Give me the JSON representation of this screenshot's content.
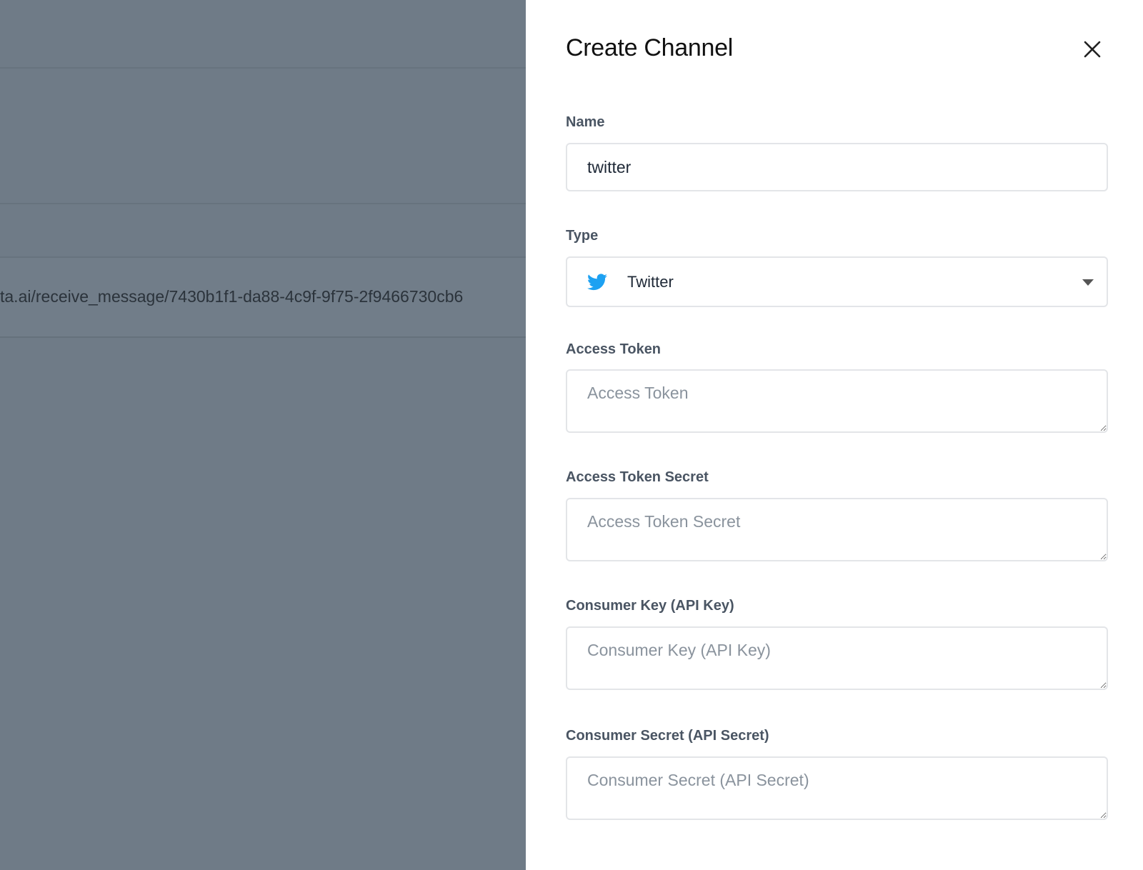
{
  "background": {
    "webhook_url_fragment": "ta.ai/receive_message/7430b1f1-da88-4c9f-9f75-2f9466730cb6"
  },
  "panel": {
    "title": "Create Channel",
    "close_icon": "close-icon",
    "fields": {
      "name": {
        "label": "Name",
        "value": "twitter"
      },
      "type": {
        "label": "Type",
        "value": "Twitter",
        "icon": "twitter-bird-icon",
        "icon_color": "#1da1f2"
      },
      "access_token": {
        "label": "Access Token",
        "placeholder": "Access Token"
      },
      "access_token_secret": {
        "label": "Access Token Secret",
        "placeholder": "Access Token Secret"
      },
      "consumer_key": {
        "label": "Consumer Key (API Key)",
        "placeholder": "Consumer Key (API Key)"
      },
      "consumer_secret": {
        "label": "Consumer Secret (API Secret)",
        "placeholder": "Consumer Secret (API Secret)"
      }
    }
  }
}
